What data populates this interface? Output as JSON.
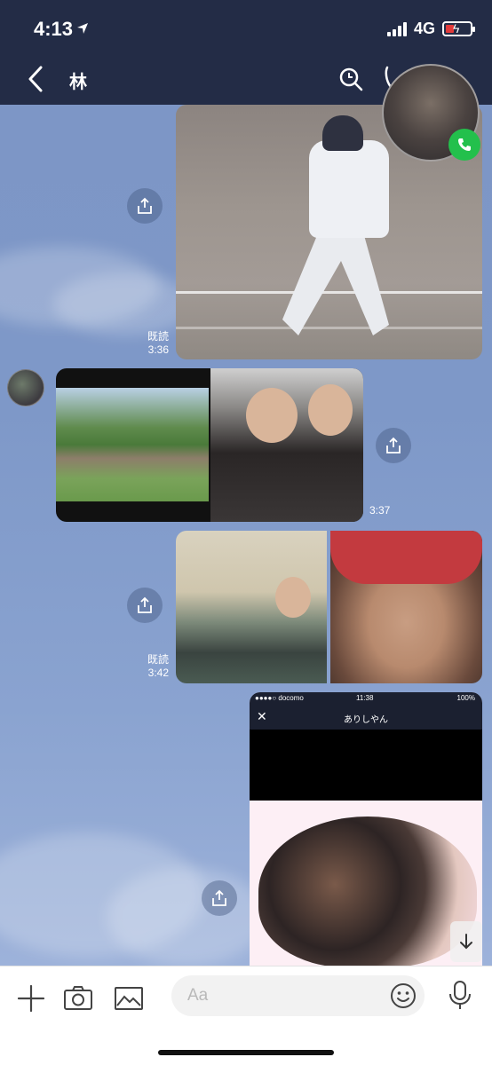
{
  "status": {
    "time": "4:13",
    "network": "4G",
    "battery_level": 0.35
  },
  "header": {
    "title": "林"
  },
  "messages": [
    {
      "type": "image",
      "subject": "baseball batter",
      "read": "既読",
      "time": "3:36"
    },
    {
      "type": "image",
      "subject": "two photos (field + friends)",
      "time": "3:37",
      "incoming": true
    },
    {
      "type": "image",
      "subject": "room + selfie",
      "read": "既読",
      "time": "3:42"
    },
    {
      "type": "image",
      "subject": "phone screenshot",
      "screenshot": {
        "carrier": "●●●●○ docomo",
        "time": "11:38",
        "battery": "100%",
        "title": "ありしやん"
      }
    }
  ],
  "input": {
    "placeholder": "Aa"
  },
  "colors": {
    "header": "#232c46",
    "accent_call": "#23c04c",
    "battery_low": "#e23b3b"
  }
}
